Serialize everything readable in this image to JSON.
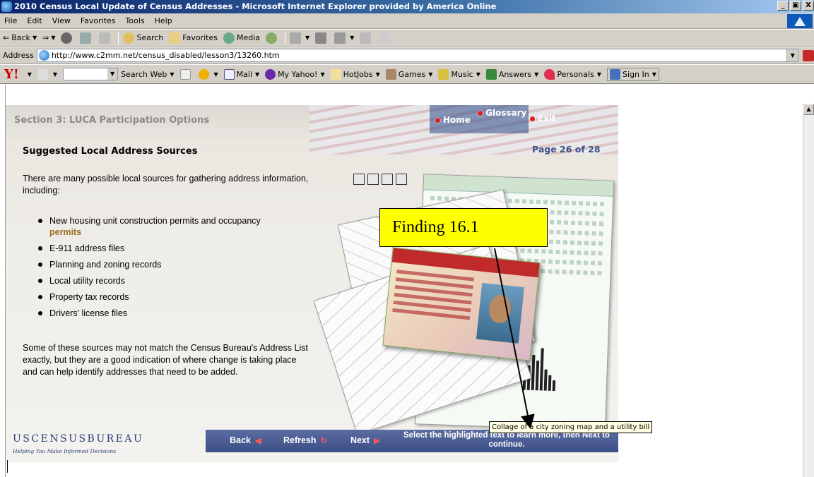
{
  "window": {
    "title": "2010 Census Local Update of Census Addresses - Microsoft Internet Explorer provided by America Online",
    "buttons": [
      "_",
      "&#8203;",
      "X"
    ]
  },
  "menu": [
    "File",
    "Edit",
    "View",
    "Favorites",
    "Tools",
    "Help"
  ],
  "toolbar": {
    "back": "Back",
    "search": "Search",
    "favorites": "Favorites",
    "media": "Media"
  },
  "address": {
    "label": "Address",
    "url": "http://www.c2mm.net/census_disabled/lesson3/13260.htm"
  },
  "yahoo": {
    "logo": "Y!",
    "search_web": "Search Web",
    "mail": "Mail",
    "my_yahoo": "My Yahoo!",
    "hotjobs": "HotJobs",
    "games": "Games",
    "music": "Music",
    "answers": "Answers",
    "personals": "Personals",
    "sign_in": "Sign In"
  },
  "lesson": {
    "section": "Section 3: LUCA Participation Options",
    "nav_home": "Home",
    "nav_glossary": "Glossary",
    "nav_exit": "Exit",
    "heading": "Suggested Local Address Sources",
    "page": "Page 26 of 28",
    "intro": "There are many possible local sources for gathering address information, including:",
    "items": [
      {
        "text": "New housing unit construction permits and occupancy",
        "keyword": "permits"
      },
      {
        "text": "E-911 address files"
      },
      {
        "text": "Planning and zoning records"
      },
      {
        "text": "Local utility records"
      },
      {
        "text": "Property tax records"
      },
      {
        "text": "Drivers' license files"
      }
    ],
    "paragraph": "Some of these sources may not match the Census Bureau's Address List exactly, but they are a good indication of where change is taking place and can help identify addresses that need to be added.",
    "logo_main": "USCENSUSBUREAU",
    "logo_tagline": "Helping You Make Informed Decisions",
    "back": "Back",
    "refresh": "Refresh",
    "next": "Next",
    "instruction": "Select the highlighted text to learn more, then Next to continue."
  },
  "annotation": {
    "finding": "Finding 16.1",
    "tooltip": "Collage of a city zoning map and a utility bill"
  }
}
